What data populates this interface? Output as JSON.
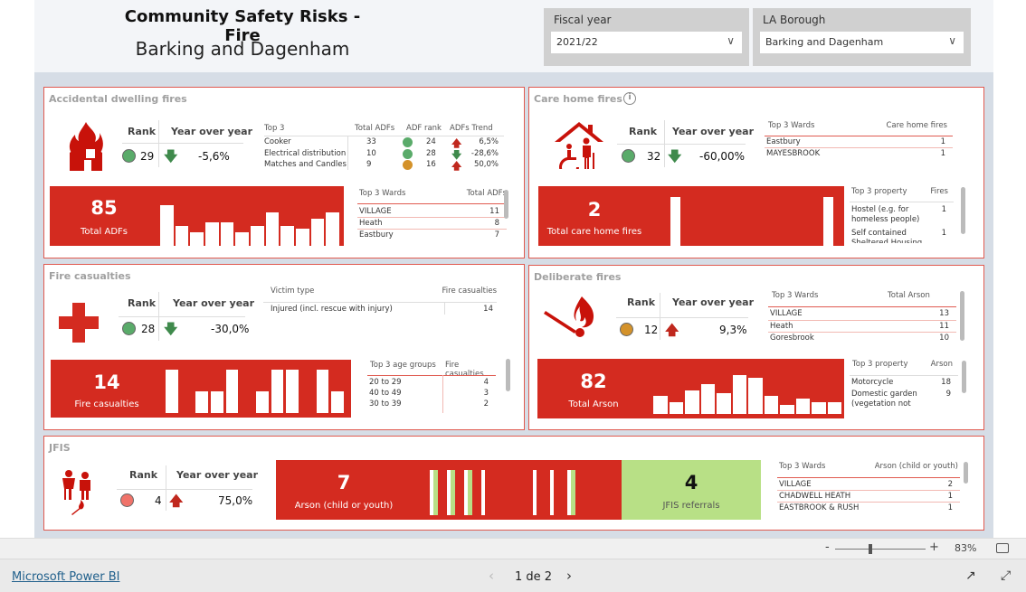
{
  "header": {
    "title": "Community Safety Risks - Fire",
    "subtitle": "Barking and Dagenham"
  },
  "slicers": {
    "fiscal_year": {
      "label": "Fiscal year",
      "value": "2021/22"
    },
    "borough": {
      "label": "LA Borough",
      "value": "Barking and Dagenham"
    }
  },
  "colors": {
    "red": "#d42b20",
    "green": "#5aab6a",
    "amber": "#d4922a",
    "light_red": "#f0736a",
    "light_green": "#b8e086"
  },
  "adf": {
    "title": "Accidental dwelling fires",
    "rank_label": "Rank",
    "yoy_label": "Year over year",
    "rank": "29",
    "rank_status": "green",
    "yoy": "-5,6%",
    "yoy_dir": "down",
    "top3": {
      "headers": [
        "Top 3",
        "Total ADFs",
        "ADF rank",
        "ADFs Trend"
      ],
      "rows": [
        {
          "name": "Cooker",
          "total": "33",
          "status": "green",
          "rank": "24",
          "dir": "up",
          "trend": "6,5%"
        },
        {
          "name": "Electrical distribution",
          "total": "10",
          "status": "green",
          "rank": "28",
          "dir": "down",
          "trend": "-28,6%"
        },
        {
          "name": "Matches and Candles",
          "total": "9",
          "status": "amber",
          "rank": "16",
          "dir": "up",
          "trend": "50,0%"
        }
      ]
    },
    "total": "85",
    "total_label": "Total ADFs",
    "monthly": [
      12,
      6,
      4,
      7,
      7,
      4,
      6,
      10,
      6,
      5,
      8,
      10
    ],
    "wards": {
      "headers": [
        "Top 3 Wards",
        "Total ADFs"
      ],
      "rows": [
        [
          "VILLAGE",
          "11"
        ],
        [
          "Heath",
          "8"
        ],
        [
          "Eastbury",
          "7"
        ]
      ]
    }
  },
  "care": {
    "title": "Care home fires",
    "rank_label": "Rank",
    "yoy_label": "Year over year",
    "rank": "32",
    "rank_status": "green",
    "yoy": "-60,00%",
    "yoy_dir": "down",
    "wards": {
      "headers": [
        "Top 3 Wards",
        "Care home fires"
      ],
      "rows": [
        [
          "Eastbury",
          "1"
        ],
        [
          "MAYESBROOK",
          "1"
        ]
      ]
    },
    "total": "2",
    "total_label": "Total care home fires",
    "monthly": [
      1,
      0,
      0,
      0,
      0,
      0,
      0,
      0,
      0,
      0,
      1
    ],
    "property": {
      "headers": [
        "Top 3 property",
        "Fires"
      ],
      "rows": [
        [
          "Hostel (e.g. for homeless people)",
          "1"
        ],
        [
          "Self contained Sheltered Housing",
          "1"
        ]
      ]
    }
  },
  "casualties": {
    "title": "Fire casualties",
    "rank_label": "Rank",
    "yoy_label": "Year over year",
    "rank": "28",
    "rank_status": "green",
    "yoy": "-30,0%",
    "yoy_dir": "down",
    "victim": {
      "headers": [
        "Victim type",
        "Fire casualties"
      ],
      "rows": [
        [
          "Injured (incl. rescue with injury)",
          "14"
        ]
      ]
    },
    "total": "14",
    "total_label": "Fire casualties",
    "monthly": [
      2,
      0,
      1,
      1,
      2,
      0,
      1,
      2,
      2,
      0,
      2,
      1
    ],
    "ages": {
      "headers": [
        "Top 3 age groups",
        "Fire casualties"
      ],
      "rows": [
        [
          "20 to 29",
          "4"
        ],
        [
          "40 to 49",
          "3"
        ],
        [
          "30 to 39",
          "2"
        ]
      ]
    }
  },
  "deliberate": {
    "title": "Deliberate fires",
    "rank_label": "Rank",
    "yoy_label": "Year over year",
    "rank": "12",
    "rank_status": "amber",
    "yoy": "9,3%",
    "yoy_dir": "up",
    "wards": {
      "headers": [
        "Top 3 Wards",
        "Total Arson"
      ],
      "rows": [
        [
          "VILLAGE",
          "13"
        ],
        [
          "Heath",
          "11"
        ],
        [
          "Goresbrook",
          "10"
        ]
      ]
    },
    "total": "82",
    "total_label": "Total Arson",
    "monthly": [
      6,
      4,
      8,
      10,
      7,
      13,
      12,
      6,
      3,
      5,
      4,
      4
    ],
    "property": {
      "headers": [
        "Top 3 property",
        "Arson"
      ],
      "rows": [
        [
          "Motorcycle",
          "18"
        ],
        [
          "Domestic garden (vegetation not",
          "9"
        ]
      ]
    }
  },
  "jfis": {
    "title": "JFIS",
    "rank_label": "Rank",
    "yoy_label": "Year over year",
    "rank": "4",
    "rank_status": "light_red",
    "yoy": "75,0%",
    "yoy_dir": "up",
    "arson": "7",
    "arson_label": "Arson (child or youth)",
    "referrals": "4",
    "referrals_label": "JFIS referrals",
    "arson_monthly": [
      1,
      1,
      1,
      1,
      0,
      0,
      1,
      1,
      1,
      0
    ],
    "referral_monthly": [
      1,
      1,
      1,
      0,
      0,
      0,
      0,
      0,
      1,
      0
    ],
    "wards": {
      "headers": [
        "Top 3 Wards",
        "Arson (child or youth)"
      ],
      "rows": [
        [
          "VILLAGE",
          "2"
        ],
        [
          "CHADWELL HEATH",
          "1"
        ],
        [
          "EASTBROOK & RUSH",
          "1"
        ]
      ]
    }
  },
  "zoom": {
    "minus": "-",
    "plus": "+",
    "value": "83%"
  },
  "footer": {
    "brand": "Microsoft Power BI",
    "page": "1 de 2"
  }
}
